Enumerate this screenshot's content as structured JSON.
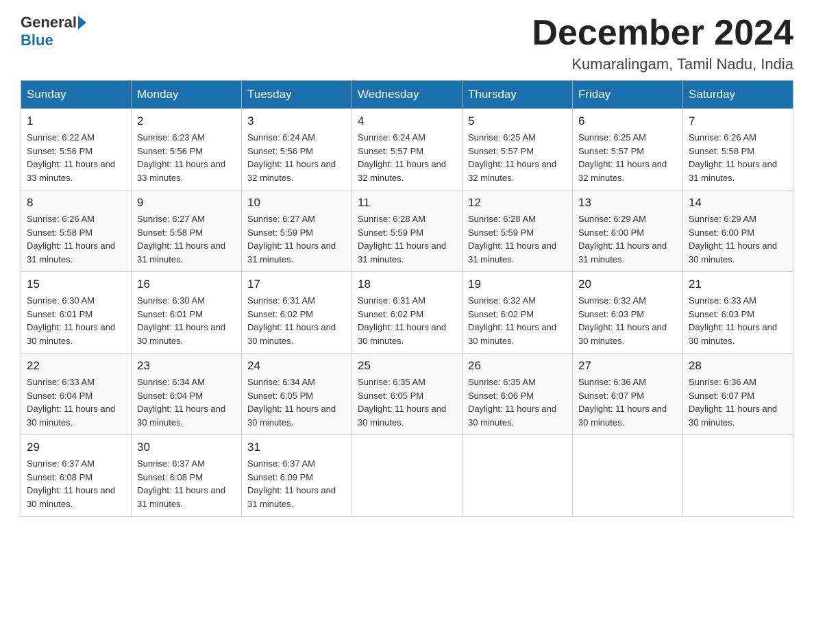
{
  "header": {
    "logo_general": "General",
    "logo_blue": "Blue",
    "month_title": "December 2024",
    "subtitle": "Kumaralingam, Tamil Nadu, India"
  },
  "weekdays": [
    "Sunday",
    "Monday",
    "Tuesday",
    "Wednesday",
    "Thursday",
    "Friday",
    "Saturday"
  ],
  "weeks": [
    [
      {
        "day": "1",
        "sunrise": "6:22 AM",
        "sunset": "5:56 PM",
        "daylight": "11 hours and 33 minutes."
      },
      {
        "day": "2",
        "sunrise": "6:23 AM",
        "sunset": "5:56 PM",
        "daylight": "11 hours and 33 minutes."
      },
      {
        "day": "3",
        "sunrise": "6:24 AM",
        "sunset": "5:56 PM",
        "daylight": "11 hours and 32 minutes."
      },
      {
        "day": "4",
        "sunrise": "6:24 AM",
        "sunset": "5:57 PM",
        "daylight": "11 hours and 32 minutes."
      },
      {
        "day": "5",
        "sunrise": "6:25 AM",
        "sunset": "5:57 PM",
        "daylight": "11 hours and 32 minutes."
      },
      {
        "day": "6",
        "sunrise": "6:25 AM",
        "sunset": "5:57 PM",
        "daylight": "11 hours and 32 minutes."
      },
      {
        "day": "7",
        "sunrise": "6:26 AM",
        "sunset": "5:58 PM",
        "daylight": "11 hours and 31 minutes."
      }
    ],
    [
      {
        "day": "8",
        "sunrise": "6:26 AM",
        "sunset": "5:58 PM",
        "daylight": "11 hours and 31 minutes."
      },
      {
        "day": "9",
        "sunrise": "6:27 AM",
        "sunset": "5:58 PM",
        "daylight": "11 hours and 31 minutes."
      },
      {
        "day": "10",
        "sunrise": "6:27 AM",
        "sunset": "5:59 PM",
        "daylight": "11 hours and 31 minutes."
      },
      {
        "day": "11",
        "sunrise": "6:28 AM",
        "sunset": "5:59 PM",
        "daylight": "11 hours and 31 minutes."
      },
      {
        "day": "12",
        "sunrise": "6:28 AM",
        "sunset": "5:59 PM",
        "daylight": "11 hours and 31 minutes."
      },
      {
        "day": "13",
        "sunrise": "6:29 AM",
        "sunset": "6:00 PM",
        "daylight": "11 hours and 31 minutes."
      },
      {
        "day": "14",
        "sunrise": "6:29 AM",
        "sunset": "6:00 PM",
        "daylight": "11 hours and 30 minutes."
      }
    ],
    [
      {
        "day": "15",
        "sunrise": "6:30 AM",
        "sunset": "6:01 PM",
        "daylight": "11 hours and 30 minutes."
      },
      {
        "day": "16",
        "sunrise": "6:30 AM",
        "sunset": "6:01 PM",
        "daylight": "11 hours and 30 minutes."
      },
      {
        "day": "17",
        "sunrise": "6:31 AM",
        "sunset": "6:02 PM",
        "daylight": "11 hours and 30 minutes."
      },
      {
        "day": "18",
        "sunrise": "6:31 AM",
        "sunset": "6:02 PM",
        "daylight": "11 hours and 30 minutes."
      },
      {
        "day": "19",
        "sunrise": "6:32 AM",
        "sunset": "6:02 PM",
        "daylight": "11 hours and 30 minutes."
      },
      {
        "day": "20",
        "sunrise": "6:32 AM",
        "sunset": "6:03 PM",
        "daylight": "11 hours and 30 minutes."
      },
      {
        "day": "21",
        "sunrise": "6:33 AM",
        "sunset": "6:03 PM",
        "daylight": "11 hours and 30 minutes."
      }
    ],
    [
      {
        "day": "22",
        "sunrise": "6:33 AM",
        "sunset": "6:04 PM",
        "daylight": "11 hours and 30 minutes."
      },
      {
        "day": "23",
        "sunrise": "6:34 AM",
        "sunset": "6:04 PM",
        "daylight": "11 hours and 30 minutes."
      },
      {
        "day": "24",
        "sunrise": "6:34 AM",
        "sunset": "6:05 PM",
        "daylight": "11 hours and 30 minutes."
      },
      {
        "day": "25",
        "sunrise": "6:35 AM",
        "sunset": "6:05 PM",
        "daylight": "11 hours and 30 minutes."
      },
      {
        "day": "26",
        "sunrise": "6:35 AM",
        "sunset": "6:06 PM",
        "daylight": "11 hours and 30 minutes."
      },
      {
        "day": "27",
        "sunrise": "6:36 AM",
        "sunset": "6:07 PM",
        "daylight": "11 hours and 30 minutes."
      },
      {
        "day": "28",
        "sunrise": "6:36 AM",
        "sunset": "6:07 PM",
        "daylight": "11 hours and 30 minutes."
      }
    ],
    [
      {
        "day": "29",
        "sunrise": "6:37 AM",
        "sunset": "6:08 PM",
        "daylight": "11 hours and 30 minutes."
      },
      {
        "day": "30",
        "sunrise": "6:37 AM",
        "sunset": "6:08 PM",
        "daylight": "11 hours and 31 minutes."
      },
      {
        "day": "31",
        "sunrise": "6:37 AM",
        "sunset": "6:09 PM",
        "daylight": "11 hours and 31 minutes."
      },
      null,
      null,
      null,
      null
    ]
  ]
}
